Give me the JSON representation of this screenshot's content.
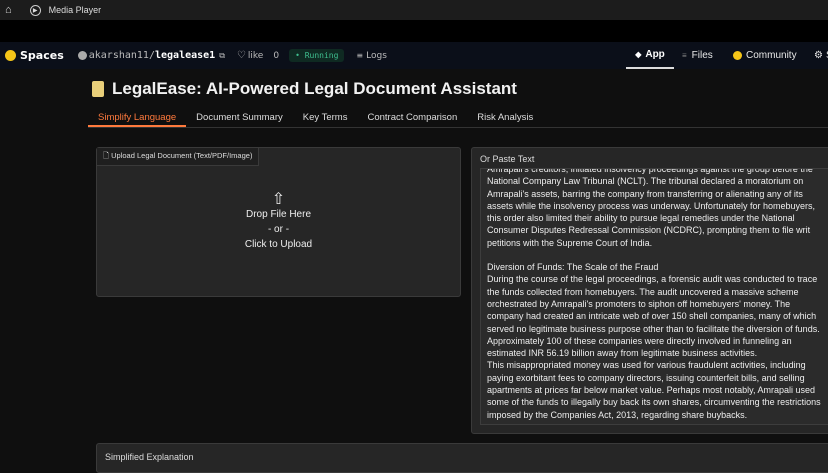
{
  "window": {
    "title": "Media Player"
  },
  "hf_header": {
    "spaces": "Spaces",
    "owner": "akarshan11/",
    "repo": "legalease1",
    "like_label": "like",
    "like_count": "0",
    "status": "Running",
    "logs": "Logs",
    "nav": [
      "App",
      "Files",
      "Community",
      "S"
    ]
  },
  "app": {
    "title": "LegalEase: AI-Powered Legal Document Assistant",
    "tabs": [
      "Simplify Language",
      "Document Summary",
      "Key Terms",
      "Contract Comparison",
      "Risk Analysis"
    ],
    "upload": {
      "label": "Upload Legal Document (Text/PDF/Image)",
      "drop": "Drop File Here",
      "or": "- or -",
      "click": "Click to Upload"
    },
    "paste": {
      "label": "Or Paste Text",
      "paragraphs": [
        "Amrapali's creditors, initiated insolvency proceedings against the group before the National Company Law Tribunal (NCLT). The tribunal declared a moratorium on Amrapali's assets, barring the company from transferring or alienating any of its assets while the insolvency process was underway. Unfortunately for homebuyers, this order also limited their ability to pursue legal remedies under the National Consumer Disputes Redressal Commission (NCDRC), prompting them to file writ petitions with the Supreme Court of India.",
        "Diversion of Funds: The Scale of the Fraud\nDuring the course of the legal proceedings, a forensic audit was conducted to trace the funds collected from homebuyers. The audit uncovered a massive scheme orchestrated by Amrapali's promoters to siphon off homebuyers' money. The company had created an intricate web of over 150 shell companies, many of which served no legitimate business purpose other than to facilitate the diversion of funds. Approximately 100 of these companies were directly involved in funneling an estimated INR 56.19 billion away from legitimate business activities.\nThis misappropriated money was used for various fraudulent activities, including paying exorbitant fees to company directors, issuing counterfeit bills, and selling apartments at prices far below market value. Perhaps most notably, Amrapali used some of the funds to illegally buy back its own shares, circumventing the restrictions imposed by the Companies Act, 2013, regarding share buybacks."
      ]
    },
    "output_label": "Simplified Explanation"
  }
}
